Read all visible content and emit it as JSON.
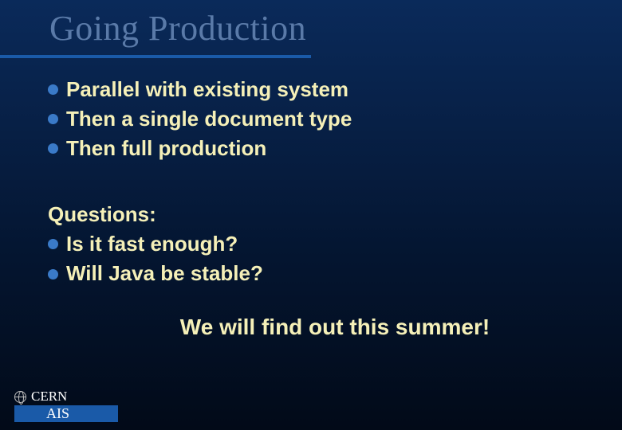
{
  "title": "Going Production",
  "bullets": {
    "b0": "Parallel with existing system",
    "b1": "Then a single document type",
    "b2": "Then full production"
  },
  "questions": {
    "heading": "Questions:",
    "q0": "Is it fast enough?",
    "q1": "Will Java be stable?"
  },
  "closing": "We will find out this summer!",
  "footer": {
    "org": "CERN",
    "dept": "AIS"
  }
}
